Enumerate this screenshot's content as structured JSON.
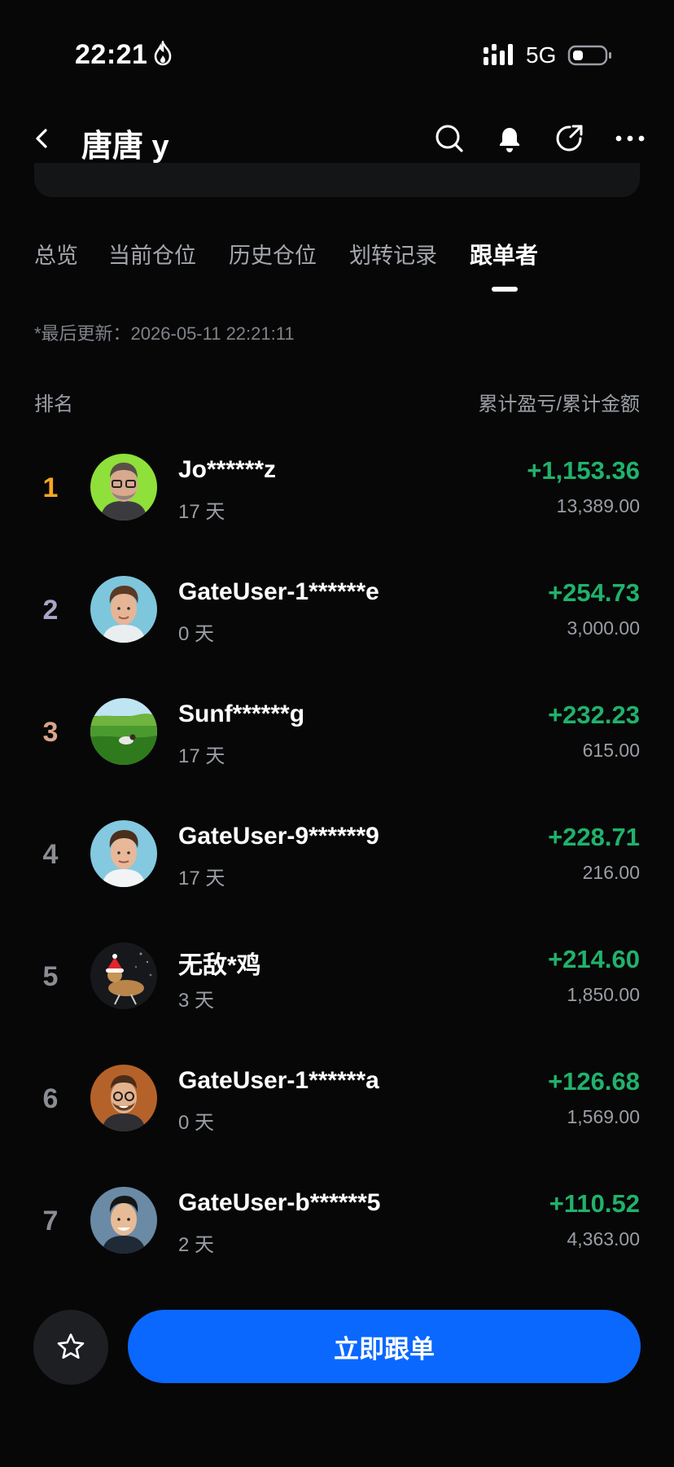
{
  "status_bar": {
    "time": "22:21",
    "network": "5G",
    "flame_icon": "flame-icon",
    "signal_icon": "signal-icon",
    "battery_icon": "battery-icon"
  },
  "header": {
    "title": "唐唐 y",
    "back_icon": "chevron-left-icon",
    "search_icon": "search-icon",
    "bell_icon": "bell-icon",
    "share_icon": "share-icon",
    "more_icon": "more-dots-icon"
  },
  "tabs": [
    {
      "label": "总览"
    },
    {
      "label": "当前仓位"
    },
    {
      "label": "历史仓位"
    },
    {
      "label": "划转记录"
    },
    {
      "label": "跟单者",
      "active": true
    }
  ],
  "updated": "*最后更新：2026-05-11 22:21:11",
  "columns": {
    "left": "排名",
    "right": "累计盈亏/累计金额"
  },
  "colors": {
    "rank_1": "#f5a623",
    "rank_2": "#a7a6c9",
    "rank_3": "#d9a58c",
    "rank_other": "#8a8d93",
    "profit": "#20b26c",
    "primary": "#0a68ff"
  },
  "followers": [
    {
      "rank": "1",
      "name": "Jo******z",
      "days": "17 天",
      "pnl": "+1,153.36",
      "amount": "13,389.00"
    },
    {
      "rank": "2",
      "name": "GateUser-1******e",
      "days": "0 天",
      "pnl": "+254.73",
      "amount": "3,000.00"
    },
    {
      "rank": "3",
      "name": "Sunf******g",
      "days": "17 天",
      "pnl": "+232.23",
      "amount": "615.00"
    },
    {
      "rank": "4",
      "name": "GateUser-9******9",
      "days": "17 天",
      "pnl": "+228.71",
      "amount": "216.00"
    },
    {
      "rank": "5",
      "name": "无敌*鸡",
      "days": "3 天",
      "pnl": "+214.60",
      "amount": "1,850.00"
    },
    {
      "rank": "6",
      "name": "GateUser-1******a",
      "days": "0 天",
      "pnl": "+126.68",
      "amount": "1,569.00"
    },
    {
      "rank": "7",
      "name": "GateUser-b******5",
      "days": "2 天",
      "pnl": "+110.52",
      "amount": "4,363.00"
    }
  ],
  "bottom": {
    "follow_label": "立即跟单",
    "fav_icon": "star-icon"
  }
}
